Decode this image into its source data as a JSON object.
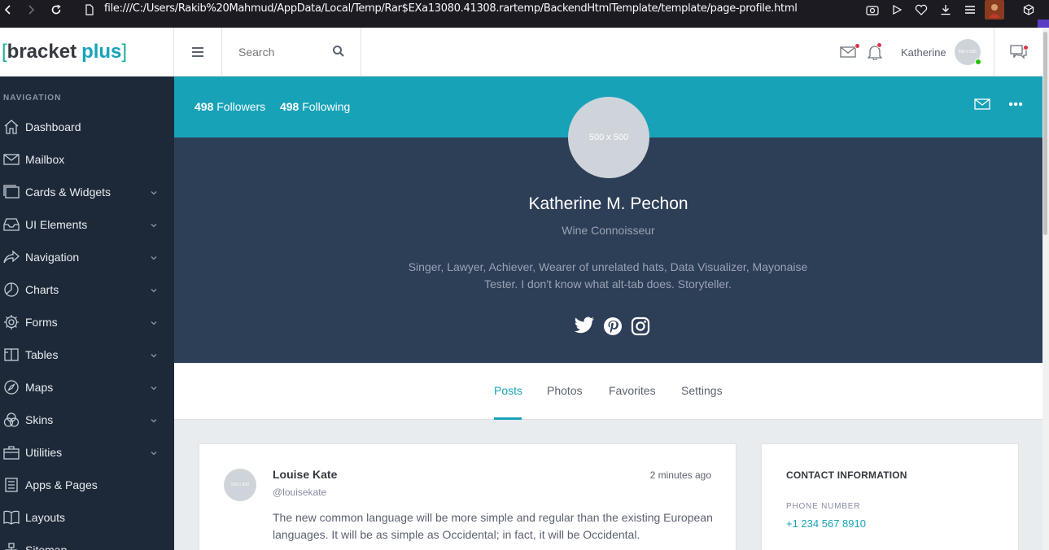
{
  "browser": {
    "url": "file:///C:/Users/Rakib%20Mahmud/AppData/Local/Temp/Rar$EXa13080.41308.rartemp/BackendHtmlTemplate/template/page-profile.html"
  },
  "logo": {
    "bracket_left": "[",
    "word1": "bracket",
    "word2": "plus",
    "bracket_right": "]"
  },
  "header": {
    "search_placeholder": "Search",
    "user_name": "Katherine",
    "avatar_text": "500 x 500"
  },
  "sidebar": {
    "label": "NAVIGATION",
    "items": [
      {
        "label": "Dashboard",
        "icon": "home-icon",
        "has_caret": false
      },
      {
        "label": "Mailbox",
        "icon": "mail-icon",
        "has_caret": false
      },
      {
        "label": "Cards & Widgets",
        "icon": "cards-icon",
        "has_caret": true
      },
      {
        "label": "UI Elements",
        "icon": "inbox-icon",
        "has_caret": true
      },
      {
        "label": "Navigation",
        "icon": "share-icon",
        "has_caret": true
      },
      {
        "label": "Charts",
        "icon": "pie-icon",
        "has_caret": true
      },
      {
        "label": "Forms",
        "icon": "gear-icon",
        "has_caret": true
      },
      {
        "label": "Tables",
        "icon": "table-icon",
        "has_caret": true
      },
      {
        "label": "Maps",
        "icon": "compass-icon",
        "has_caret": true
      },
      {
        "label": "Skins",
        "icon": "skins-icon",
        "has_caret": true
      },
      {
        "label": "Utilities",
        "icon": "briefcase-icon",
        "has_caret": true
      },
      {
        "label": "Apps & Pages",
        "icon": "list-icon",
        "has_caret": false
      },
      {
        "label": "Layouts",
        "icon": "book-icon",
        "has_caret": false
      },
      {
        "label": "Sitemap",
        "icon": "sitemap-icon",
        "has_caret": false
      }
    ]
  },
  "profile": {
    "followers_count": "498",
    "followers_label": "Followers",
    "following_count": "498",
    "following_label": "Following",
    "avatar_text": "500 x 500",
    "name": "Katherine M. Pechon",
    "title": "Wine Connoisseur",
    "bio": "Singer, Lawyer, Achiever, Wearer of unrelated hats, Data Visualizer, Mayonaise Tester. I don't know what alt-tab does. Storyteller."
  },
  "tabs": [
    "Posts",
    "Photos",
    "Favorites",
    "Settings"
  ],
  "active_tab": "Posts",
  "post": {
    "avatar_text": "500 x 500",
    "author": "Louise Kate",
    "handle": "@louisekate",
    "time": "2 minutes ago",
    "text": "The new common language will be more simple and regular than the existing European languages. It will be as simple as Occidental; in fact, it will be Occidental."
  },
  "contact": {
    "heading": "CONTACT INFORMATION",
    "phone_label": "PHONE NUMBER",
    "phone_value": "+1 234 567 8910"
  },
  "colors": {
    "accent": "#17a2b8",
    "sidebar": "#1d2939",
    "cover": "#2d3e57"
  }
}
